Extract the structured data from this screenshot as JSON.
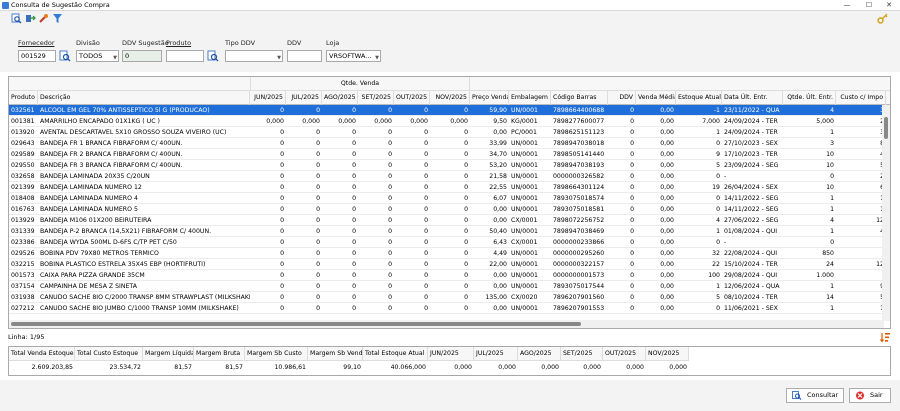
{
  "window": {
    "title": "Consulta de Sugestão Compra",
    "minimize": "—",
    "maximize": "☐",
    "close": "✕"
  },
  "toolbar": {
    "icons": [
      "search-report-icon",
      "transfer-icon",
      "wrench-icon",
      "filter-icon",
      "key-icon"
    ]
  },
  "filters": {
    "fornecedor": {
      "label": "Fornecedor",
      "value": "001529"
    },
    "divisao": {
      "label": "Divisão",
      "value": "TODOS"
    },
    "ddv_sugestao": {
      "label": "DDV Sugestão",
      "value": "0"
    },
    "produto": {
      "label": "Produto",
      "value": ""
    },
    "tipo_ddv": {
      "label": "Tipo DDV",
      "value": ""
    },
    "ddv": {
      "label": "DDV",
      "value": ""
    },
    "loja": {
      "label": "Loja",
      "value": "VRSOFTWA..."
    }
  },
  "grid": {
    "group_header": "Qtde. Venda",
    "columns": [
      "Produto",
      "Descrição",
      "JUN/2025",
      "JUL/2025",
      "AGO/2025",
      "SET/2025",
      "OUT/2025",
      "NOV/2025",
      "Preço Venda",
      "Embalagem",
      "Código Barras",
      "DDV",
      "Venda Média",
      "Estoque Atual",
      "Data Últ. Entr.",
      "Qtde. Últ. Entr.",
      "Custo c/ Impo"
    ],
    "rows": [
      {
        "produto": "032561",
        "descricao": "ALCOOL EM GEL 70% ANTISSEPTICO 5l G (PRODUCAO)",
        "jun": "0",
        "jul": "0",
        "ago": "0",
        "set": "0",
        "out": "0",
        "nov": "0",
        "preco": "59,90",
        "emb": "UN/0001",
        "barras": "7898664400688",
        "ddv": "0",
        "media": "0,00",
        "estoque": "-1",
        "data": "23/11/2022 - QUA",
        "qtde_ult": "4",
        "custo": "3"
      },
      {
        "produto": "001381",
        "descricao": "AMARRILHO ENCAPADO 01X1KG ( UC )",
        "jun": "0,000",
        "jul": "0,000",
        "ago": "0,000",
        "set": "0,000",
        "out": "0,000",
        "nov": "0,000",
        "preco": "9,50",
        "emb": "KG/0001",
        "barras": "7898277600077",
        "ddv": "0",
        "media": "0,00",
        "estoque": "7,000",
        "data": "24/09/2024 - TER",
        "qtde_ult": "5,000",
        "custo": "2"
      },
      {
        "produto": "013920",
        "descricao": "AVENTAL DESCARTAVEL 5X10 GROSSO SOUZA VIVEIRO (UC)",
        "jun": "0",
        "jul": "0",
        "ago": "0",
        "set": "0",
        "out": "0",
        "nov": "0",
        "preco": "0,00",
        "emb": "PC/0001",
        "barras": "7898625151123",
        "ddv": "0",
        "media": "0,00",
        "estoque": "1",
        "data": "24/09/2024 - TER",
        "qtde_ult": "1",
        "custo": "3"
      },
      {
        "produto": "029643",
        "descricao": "BANDEJA FR 1 BRANCA FIBRAFORM C/ 400UN.",
        "jun": "0",
        "jul": "0",
        "ago": "0",
        "set": "0",
        "out": "0",
        "nov": "0",
        "preco": "33,99",
        "emb": "UN/0001",
        "barras": "7898947038018",
        "ddv": "0",
        "media": "0,00",
        "estoque": "0",
        "data": "27/10/2023 - SEX",
        "qtde_ult": "3",
        "custo": "8"
      },
      {
        "produto": "029589",
        "descricao": "BANDEJA FR 2 BRANCA FIBRAFORM C/ 400UN.",
        "jun": "0",
        "jul": "0",
        "ago": "0",
        "set": "0",
        "out": "0",
        "nov": "0",
        "preco": "34,70",
        "emb": "UN/0001",
        "barras": "7898505141440",
        "ddv": "0",
        "media": "0,00",
        "estoque": "9",
        "data": "17/10/2023 - TER",
        "qtde_ult": "10",
        "custo": "4"
      },
      {
        "produto": "029550",
        "descricao": "BANDEJA FR 3 BRANCA FIBRAFORM C/ 400UN.",
        "jun": "0",
        "jul": "0",
        "ago": "0",
        "set": "0",
        "out": "0",
        "nov": "0",
        "preco": "53,20",
        "emb": "UN/0001",
        "barras": "7898947038193",
        "ddv": "0",
        "media": "0,00",
        "estoque": "5",
        "data": "23/09/2024 - SEG",
        "qtde_ult": "10",
        "custo": "5"
      },
      {
        "produto": "032658",
        "descricao": "BANDEJA LAMINADA 20X35 C/20UN",
        "jun": "0",
        "jul": "0",
        "ago": "0",
        "set": "0",
        "out": "0",
        "nov": "0",
        "preco": "21,58",
        "emb": "UN/0001",
        "barras": "0000000326582",
        "ddv": "0",
        "media": "0,00",
        "estoque": "0",
        "data": "-",
        "qtde_ult": "0",
        "custo": "2"
      },
      {
        "produto": "021399",
        "descricao": "BANDEJA LAMINADA NUMERO 12",
        "jun": "0",
        "jul": "0",
        "ago": "0",
        "set": "0",
        "out": "0",
        "nov": "0",
        "preco": "22,55",
        "emb": "UN/0001",
        "barras": "7898664301124",
        "ddv": "0",
        "media": "0,00",
        "estoque": "19",
        "data": "26/04/2024 - SEX",
        "qtde_ult": "10",
        "custo": "6"
      },
      {
        "produto": "018408",
        "descricao": "BANDEJA LAMINADA NUMERO 4",
        "jun": "0",
        "jul": "0",
        "ago": "0",
        "set": "0",
        "out": "0",
        "nov": "0",
        "preco": "6,07",
        "emb": "UN/0001",
        "barras": "7893075018574",
        "ddv": "0",
        "media": "0,00",
        "estoque": "0",
        "data": "14/11/2022 - SEG",
        "qtde_ult": "1",
        "custo": "1"
      },
      {
        "produto": "016763",
        "descricao": "BANDEJA LAMINADA NUMERO 5",
        "jun": "0",
        "jul": "0",
        "ago": "0",
        "set": "0",
        "out": "0",
        "nov": "0",
        "preco": "0,00",
        "emb": "UN/0001",
        "barras": "7893075018581",
        "ddv": "0",
        "media": "0,00",
        "estoque": "0",
        "data": "14/11/2022 - SEG",
        "qtde_ult": "1",
        "custo": "1"
      },
      {
        "produto": "013929",
        "descricao": "BANDEJA M106 01X200 BEIRUTEIRA",
        "jun": "0",
        "jul": "0",
        "ago": "0",
        "set": "0",
        "out": "0",
        "nov": "0",
        "preco": "0,00",
        "emb": "CX/0001",
        "barras": "7898072256752",
        "ddv": "0",
        "media": "0,00",
        "estoque": "4",
        "data": "27/06/2022 - SEG",
        "qtde_ult": "4",
        "custo": "12"
      },
      {
        "produto": "031339",
        "descricao": "BANDEJA P-2 BRANCA (14,5X21) FIBRAFORM C/ 400UN.",
        "jun": "0",
        "jul": "0",
        "ago": "0",
        "set": "0",
        "out": "0",
        "nov": "0",
        "preco": "50,40",
        "emb": "UN/0001",
        "barras": "7898947038469",
        "ddv": "0",
        "media": "0,00",
        "estoque": "1",
        "data": "01/08/2024 - QUI",
        "qtde_ult": "1",
        "custo": "4"
      },
      {
        "produto": "023386",
        "descricao": "BANDEJA WYDA 500ML D-6FS C/TP PET C/50",
        "jun": "0",
        "jul": "0",
        "ago": "0",
        "set": "0",
        "out": "0",
        "nov": "0",
        "preco": "6,43",
        "emb": "CX/0001",
        "barras": "0000000233866",
        "ddv": "0",
        "media": "0,00",
        "estoque": "0",
        "data": "-",
        "qtde_ult": "0",
        "custo": ""
      },
      {
        "produto": "029526",
        "descricao": "BOBINA PDV 79X80 METROS TERMICO",
        "jun": "0",
        "jul": "0",
        "ago": "0",
        "set": "0",
        "out": "0",
        "nov": "0",
        "preco": "4,49",
        "emb": "UN/0001",
        "barras": "0000000295260",
        "ddv": "0",
        "media": "0,00",
        "estoque": "32",
        "data": "22/08/2024 - QUI",
        "qtde_ult": "850",
        "custo": ""
      },
      {
        "produto": "032215",
        "descricao": "BOBINA PLASTICO ESTRELA 35X45 EBP (HORTIFRUTI)",
        "jun": "0",
        "jul": "0",
        "ago": "0",
        "set": "0",
        "out": "0",
        "nov": "0",
        "preco": "22,00",
        "emb": "UN/0001",
        "barras": "0000000322157",
        "ddv": "0",
        "media": "0,00",
        "estoque": "22",
        "data": "15/10/2024 - TER",
        "qtde_ult": "24",
        "custo": "12"
      },
      {
        "produto": "001573",
        "descricao": "CAIXA PARA PIZZA GRANDE 35CM",
        "jun": "0",
        "jul": "0",
        "ago": "0",
        "set": "0",
        "out": "0",
        "nov": "0",
        "preco": "0,00",
        "emb": "UN/0001",
        "barras": "0000000001573",
        "ddv": "0",
        "media": "0,00",
        "estoque": "100",
        "data": "29/08/2024 - QUI",
        "qtde_ult": "1.000",
        "custo": ""
      },
      {
        "produto": "037154",
        "descricao": "CAMPAINHA DE MESA Z SINETA",
        "jun": "0",
        "jul": "0",
        "ago": "0",
        "set": "0",
        "out": "0",
        "nov": "0",
        "preco": "0,00",
        "emb": "UN/0001",
        "barras": "7893075017544",
        "ddv": "0",
        "media": "0,00",
        "estoque": "1",
        "data": "12/06/2024 - QUA",
        "qtde_ult": "1",
        "custo": "9"
      },
      {
        "produto": "031938",
        "descricao": "CANUDO SACHE 8IO C/2000 TRANSP 8MM STRAWPLAST (MILKSHAKE)",
        "jun": "0",
        "jul": "0",
        "ago": "0",
        "set": "0",
        "out": "0",
        "nov": "0",
        "preco": "135,00",
        "emb": "CX/0020",
        "barras": "7896207901560",
        "ddv": "0",
        "media": "0,00",
        "estoque": "5",
        "data": "08/10/2024 - TER",
        "qtde_ult": "14",
        "custo": "5"
      },
      {
        "produto": "027212",
        "descricao": "CANUDO SACHE 8IO JUMBO C/1000 TRANSP 10MM (MILKSHAKE)",
        "jun": "0",
        "jul": "0",
        "ago": "0",
        "set": "0",
        "out": "0",
        "nov": "0",
        "preco": "0,00",
        "emb": "UN/0001",
        "barras": "7896207901553",
        "ddv": "0",
        "media": "0,00",
        "estoque": "0",
        "data": "11/06/2021 - SEX",
        "qtde_ult": "1",
        "custo": "1"
      }
    ]
  },
  "status": {
    "linha": "Linha: 1/95"
  },
  "totals": {
    "headers": [
      "Total Venda Estoque",
      "Total Custo Estoque",
      "Margem Líquida",
      "Margem Bruta",
      "Margem Sb Custo",
      "Margem Sb Venda",
      "Total Estoque Atual",
      "JUN/2025",
      "JUL/2025",
      "AGO/2025",
      "SET/2025",
      "OUT/2025",
      "NOV/2025"
    ],
    "values": [
      "2.609.203,85",
      "23.534,72",
      "81,57",
      "81,57",
      "10.986,61",
      "99,10",
      "40.066,000",
      "0,000",
      "0,000",
      "0,000",
      "0,000",
      "0,000",
      "0,000"
    ]
  },
  "buttons": {
    "consultar": "Consultar",
    "sair": "Sair"
  }
}
